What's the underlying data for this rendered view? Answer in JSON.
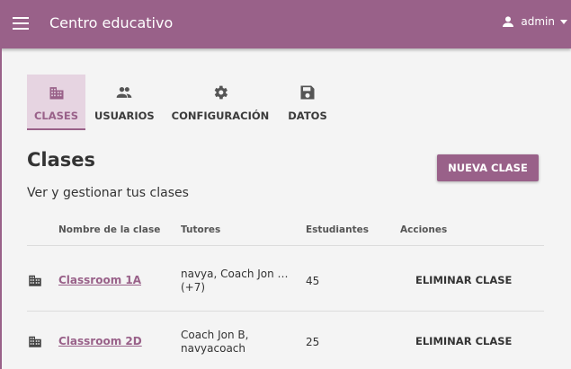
{
  "appbar": {
    "title": "Centro educativo",
    "user_name": "admin"
  },
  "tabs": [
    {
      "label": "CLASES",
      "icon": "building-icon",
      "active": true
    },
    {
      "label": "USUARIOS",
      "icon": "people-icon",
      "active": false
    },
    {
      "label": "CONFIGURACIÓN",
      "icon": "gear-icon",
      "active": false
    },
    {
      "label": "DATOS",
      "icon": "save-icon",
      "active": false
    }
  ],
  "page": {
    "title": "Clases",
    "subtitle": "Ver y gestionar tus clases",
    "new_class_label": "NUEVA CLASE"
  },
  "table": {
    "headers": [
      "Nombre de la clase",
      "Tutores",
      "Estudiantes",
      "Acciones"
    ],
    "rows": [
      {
        "name": "Classroom 1A",
        "tutors_line1": "navya, Coach Jon B...",
        "tutors_line2": "(+7)",
        "students": "45",
        "action": "ELIMINAR CLASE"
      },
      {
        "name": "Classroom 2D",
        "tutors_line1": "Coach Jon B,",
        "tutors_line2": "navyacoach",
        "students": "25",
        "action": "ELIMINAR CLASE"
      }
    ]
  },
  "colors": {
    "brand": "#996189",
    "active_tab_bg": "#e6d4e1",
    "background": "#f4f4f4"
  }
}
